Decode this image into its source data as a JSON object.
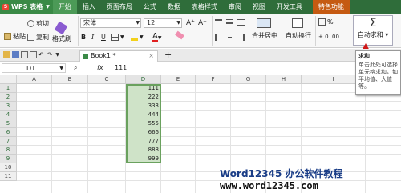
{
  "menubar": {
    "app_label": "WPS 表格",
    "items": [
      "开始",
      "插入",
      "页面布局",
      "公式",
      "数据",
      "表格样式",
      "审阅",
      "视图",
      "开发工具",
      "特色功能"
    ]
  },
  "ribbon": {
    "cut": "剪切",
    "paste": "粘贴",
    "copy": "复制",
    "format_painter": "格式刷",
    "font_name": "宋体",
    "font_size": "12",
    "grow_font": "A⁺",
    "shrink_font": "A⁻",
    "bold": "B",
    "italic": "I",
    "underline": "U",
    "merge_center": "合并居中",
    "wrap_text": "自动换行",
    "percent": "%",
    "autosum": "自动求和",
    "colors": {
      "accent": "#2f6d3a",
      "arrow": "#d01818"
    }
  },
  "tabbar": {
    "book_name": "Book1 *",
    "new_tab": "+"
  },
  "formula_bar": {
    "cell_ref": "D1",
    "fx": "fx",
    "value": "111"
  },
  "sheet": {
    "columns": [
      "A",
      "B",
      "C",
      "D",
      "E",
      "F",
      "G",
      "H",
      "I"
    ],
    "rows": [
      "1",
      "2",
      "3",
      "4",
      "5",
      "6",
      "7",
      "8",
      "9",
      "10",
      "11"
    ],
    "d_values": [
      "111",
      "222",
      "333",
      "444",
      "555",
      "666",
      "777",
      "888",
      "999"
    ]
  },
  "tooltip": {
    "title": "求和",
    "body": "单击此处可选择单元格求和，如平均值、大值等。"
  },
  "watermark": {
    "brand": "Word12345 办公软件教程",
    "url": "www.word12345.com"
  }
}
